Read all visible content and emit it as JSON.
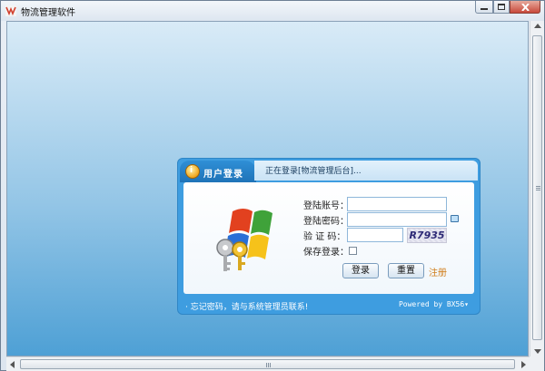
{
  "window": {
    "title": "物流管理软件",
    "controls": {
      "minimize": "—",
      "maximize": "□",
      "close": "✕"
    }
  },
  "login": {
    "tab_label": "用户登录",
    "tab_icon": "user-info-icon",
    "status": "正在登录[物流管理后台]...",
    "fields": {
      "username_label": "登陆账号：",
      "username_value": "",
      "password_label": "登陆密码：",
      "password_value": "",
      "code_label": "验 证 码：",
      "code_value": "",
      "captcha_text": "R7935",
      "save_label": "保存登录："
    },
    "buttons": {
      "login": "登录",
      "reset": "重置",
      "register": "注册"
    },
    "footer": {
      "hint": "· 忘记密码，请与系统管理员联系!",
      "powered": "Powered by BX56▾"
    }
  },
  "colors": {
    "panel": "#3e9de0",
    "register": "#d07d1a",
    "close": "#c8493a"
  }
}
